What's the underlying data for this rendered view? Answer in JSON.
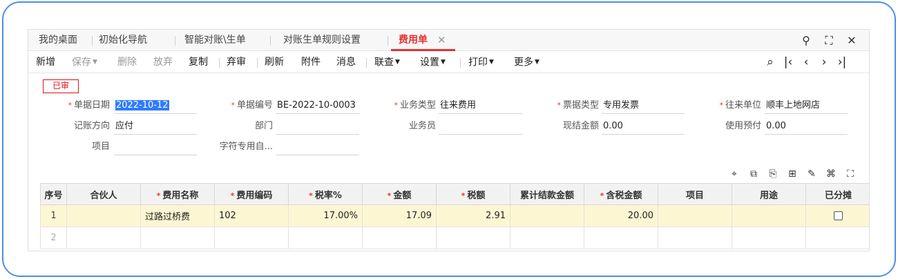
{
  "tabs": [
    {
      "label": "我的桌面"
    },
    {
      "label": "初始化导航"
    },
    {
      "label": "智能对账\\生单"
    },
    {
      "label": "对账生单规则设置"
    },
    {
      "label": "费用单",
      "active": true
    }
  ],
  "window_icons": {
    "search": "⚲",
    "maximize": "⛶",
    "close": "✕"
  },
  "toolbar": {
    "add": "新增",
    "save": "保存",
    "delete": "删除",
    "discard": "放弃",
    "copy": "复制",
    "abandon": "弃审",
    "refresh": "刷新",
    "attach": "附件",
    "message": "消息",
    "link": "联查",
    "settings": "设置",
    "print": "打印",
    "more": "更多"
  },
  "status_badge": "已审",
  "form": {
    "doc_date": {
      "label": "单据日期",
      "value": "2022-10-12",
      "required": true
    },
    "doc_no": {
      "label": "单据编号",
      "value": "BE-2022-10-0003",
      "required": true
    },
    "biz_type": {
      "label": "业务类型",
      "value": "往来费用",
      "required": true
    },
    "invoice_type": {
      "label": "票据类型",
      "value": "专用发票",
      "required": true
    },
    "partner": {
      "label": "往来单位",
      "value": "顺丰上地网店",
      "required": true
    },
    "acct_direction": {
      "label": "记账方向",
      "value": "应付"
    },
    "department": {
      "label": "部门",
      "value": ""
    },
    "salesperson": {
      "label": "业务员",
      "value": ""
    },
    "cash_amount": {
      "label": "现结金额",
      "value": "0.00"
    },
    "prepay_used": {
      "label": "使用预付",
      "value": "0.00"
    },
    "project": {
      "label": "项目",
      "value": ""
    },
    "char_custom": {
      "label": "字符专用自...",
      "value": ""
    }
  },
  "grid": {
    "columns": [
      {
        "label": "序号",
        "required": false
      },
      {
        "label": "合伙人",
        "required": false
      },
      {
        "label": "费用名称",
        "required": true
      },
      {
        "label": "费用编码",
        "required": true
      },
      {
        "label": "税率%",
        "required": true
      },
      {
        "label": "金额",
        "required": true
      },
      {
        "label": "税额",
        "required": true
      },
      {
        "label": "累计结款金额",
        "required": false
      },
      {
        "label": "含税金额",
        "required": true
      },
      {
        "label": "项目",
        "required": false
      },
      {
        "label": "用途",
        "required": false
      },
      {
        "label": "已分摊",
        "required": false
      }
    ],
    "rows": [
      {
        "idx": "1",
        "partner": "",
        "fee_name": "过路过桥费",
        "fee_code": "102",
        "tax_rate": "17.00%",
        "amount": "17.09",
        "tax": "2.91",
        "paid": "",
        "amount_incl_tax": "20.00",
        "project": "",
        "purpose": "",
        "allocated": false
      },
      {
        "idx": "2",
        "partner": "",
        "fee_name": "",
        "fee_code": "",
        "tax_rate": "",
        "amount": "",
        "tax": "",
        "paid": "",
        "amount_incl_tax": "",
        "project": "",
        "purpose": "",
        "allocated": false
      }
    ]
  },
  "colors": {
    "accent": "#e83030",
    "frame": "#4d8ee8",
    "row_highlight": "#fdf6d3",
    "selection": "#2f7bff"
  }
}
